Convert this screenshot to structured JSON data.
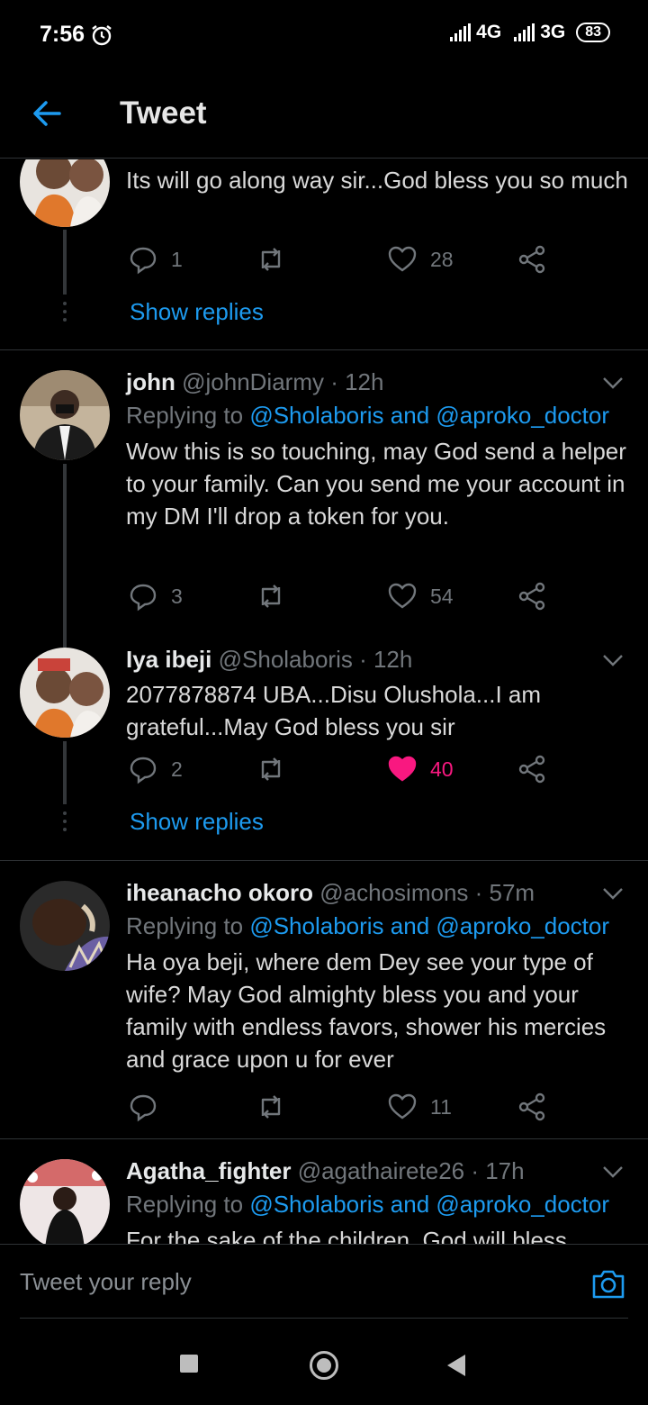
{
  "status_bar": {
    "time": "7:56",
    "network_1": "4G",
    "network_2": "3G",
    "battery": "83"
  },
  "header": {
    "title": "Tweet"
  },
  "colors": {
    "accent": "#1d9bf0",
    "like_active": "#f91880"
  },
  "tweets": [
    {
      "body": "Its will go along way sir...God bless you so much",
      "replies": "1",
      "retweets": "",
      "likes": "28",
      "show_replies": "Show replies"
    },
    {
      "name": "john",
      "handle_time": "@johnDiarmy · 12h",
      "replying_prefix": "Replying to ",
      "mentions": "@Sholaboris and @aproko_doctor",
      "body": "Wow this is so touching, may God send a helper to your family. Can you send me your account in my DM I'll drop a token for you.",
      "replies": "3",
      "retweets": "",
      "likes": "54"
    },
    {
      "name": "Iya ibeji",
      "handle_time": "@Sholaboris · 12h",
      "body": "2077878874 UBA...Disu Olushola...I am grateful...May God bless you sir",
      "replies": "2",
      "retweets": "",
      "likes": "40",
      "liked": true,
      "show_replies": "Show replies"
    },
    {
      "name": "iheanacho okoro",
      "handle_time": "@achosimons · 57m",
      "replying_prefix": "Replying to ",
      "mentions": "@Sholaboris and @aproko_doctor",
      "body": "Ha oya beji, where dem Dey see your type of wife? May God almighty bless you and your family with endless favors, shower his mercies and grace upon u for ever",
      "replies": "",
      "retweets": "",
      "likes": "11"
    },
    {
      "name": "Agatha_fighter",
      "handle_time": "@agathairete26 · 17h",
      "replying_prefix": "Replying to ",
      "mentions": "@Sholaboris and @aproko_doctor",
      "body": "For the sake of the children, God will bless"
    }
  ],
  "reply_bar": {
    "placeholder": "Tweet your reply"
  }
}
